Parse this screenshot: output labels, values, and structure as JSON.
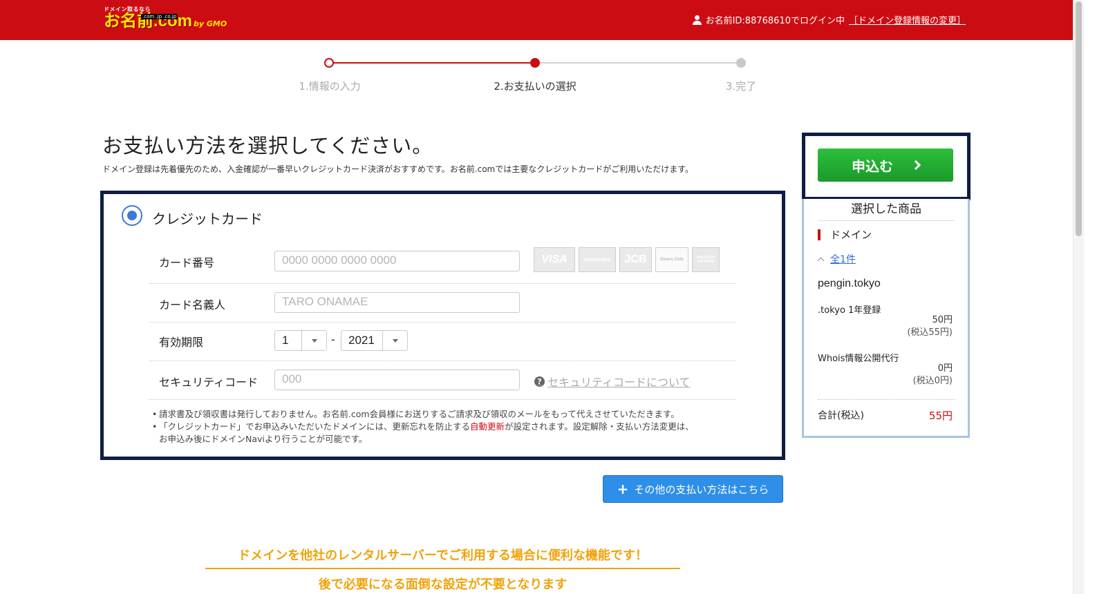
{
  "header": {
    "logo_tagline": "ドメイン取るなら",
    "logo_tlds": ".com .jp .co.jp",
    "logo_main": "お名前.com",
    "logo_gmo": "by GMO",
    "login_text": "お名前ID:88768610でログイン中",
    "change_link": "［ドメイン登録情報の変更］"
  },
  "steps": [
    {
      "label": "1.情報の入力",
      "state": "done"
    },
    {
      "label": "2.お支払いの選択",
      "state": "current"
    },
    {
      "label": "3.完了",
      "state": "todo"
    }
  ],
  "main": {
    "title": "お支払い方法を選択してください。",
    "description": "ドメイン登録は先着優先のため、入金確認が一番早いクレジットカード決済がおすすめです。お名前.comでは主要なクレジットカードがご利用いただけます。"
  },
  "credit_card": {
    "title": "クレジットカード",
    "card_number_label": "カード番号",
    "card_number_placeholder": "0000 0000 0000 0000",
    "card_brands": [
      "VISA",
      "mastercard",
      "JCB",
      "Diners Club",
      "AMERICAN EXPRESS"
    ],
    "holder_label": "カード名義人",
    "holder_placeholder": "TARO ONAMAE",
    "expiry_label": "有効期限",
    "expiry_month": "1",
    "expiry_sep": "-",
    "expiry_year": "2021",
    "cvc_label": "セキュリティコード",
    "cvc_placeholder": "000",
    "cvc_help": "セキュリティコードについて",
    "notes": {
      "note1": "請求書及び領収書は発行しておりません。お名前.com会員様にお送りするご請求及び領収のメールをもって代えさせていただきます。",
      "note2_prefix": "「クレジットカード」でお申込みいただいたドメインには、更新忘れを防止する",
      "note2_highlight": "自動更新",
      "note2_suffix": "が設定されます。設定解除・支払い方法変更は、",
      "note2_line2": "お申込み後にドメインNaviより行うことが可能です。"
    }
  },
  "other_payment_button": "その他の支払い方法はこちら",
  "promo": {
    "title": "ドメインを他社のレンタルサーバーでご利用する場合に便利な機能です！",
    "subtitle": "後で必要になる面倒な設定が不要となります"
  },
  "sidebar": {
    "apply_button": "申込む",
    "summary_title": "選択した商品",
    "category": "ドメイン",
    "count_link": "全1件",
    "domain": "pengin.tokyo",
    "items": [
      {
        "name": ".tokyo 1年登録",
        "price": "50円",
        "tax": "(税込55円)"
      },
      {
        "name": "Whois情報公開代行",
        "price": "0円",
        "tax": "(税込0円)"
      }
    ],
    "total_label": "合計(税込)",
    "total_value": "55円"
  },
  "colors": {
    "header_red": "#cc0c13",
    "accent_blue": "#3a7bd5",
    "apply_green": "#22b033",
    "highlight_border": "#0f1d44",
    "promo_orange": "#f0a30a"
  }
}
